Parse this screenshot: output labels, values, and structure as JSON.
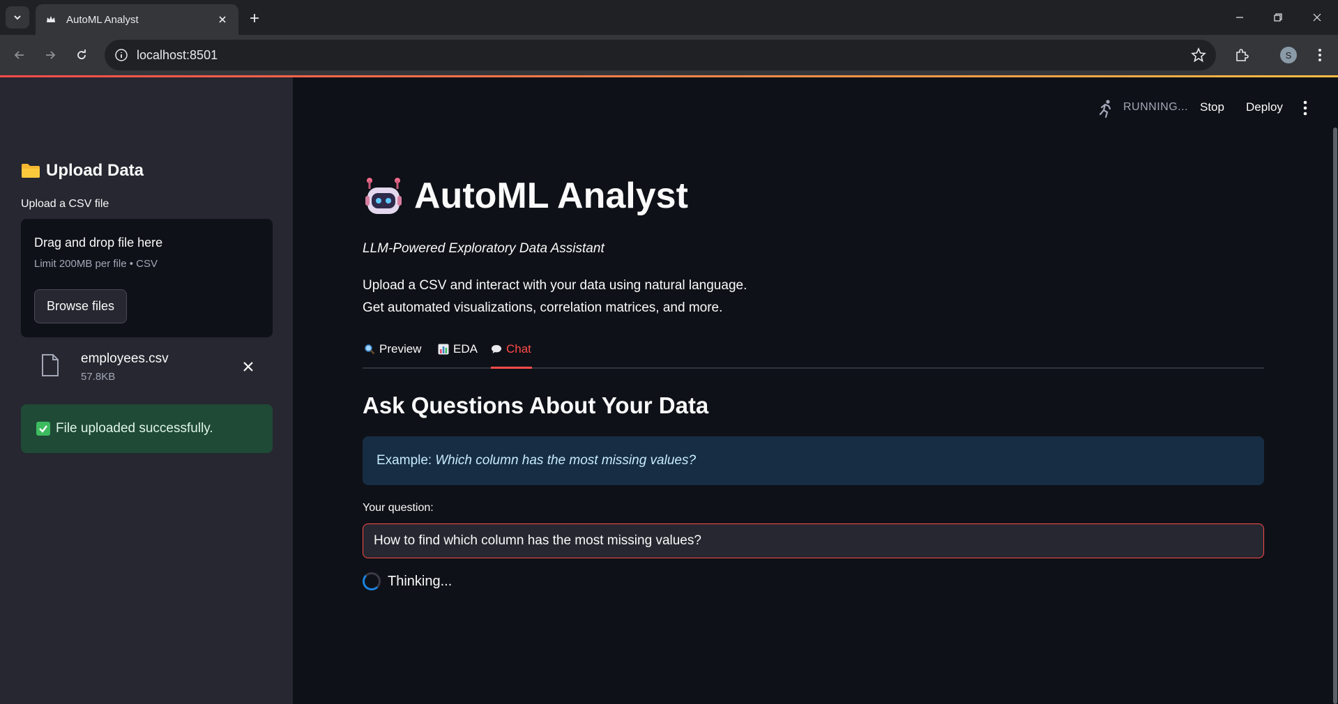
{
  "browser": {
    "tab_title": "AutoML Analyst",
    "url": "localhost:8501",
    "profile_initial": "S"
  },
  "sidebar": {
    "header": "Upload Data",
    "upload_label": "Upload a CSV file",
    "dropzone_title": "Drag and drop file here",
    "dropzone_limit": "Limit 200MB per file • CSV",
    "browse_label": "Browse files",
    "file": {
      "name": "employees.csv",
      "size": "57.8KB"
    },
    "success_message": "File uploaded successfully."
  },
  "header": {
    "status": "RUNNING...",
    "stop_label": "Stop",
    "deploy_label": "Deploy"
  },
  "main": {
    "title": "AutoML Analyst",
    "subtitle": "LLM-Powered Exploratory Data Assistant",
    "desc_line1": "Upload a CSV and interact with your data using natural language.",
    "desc_line2": "Get automated visualizations, correlation matrices, and more.",
    "tabs": [
      {
        "label": "Preview"
      },
      {
        "label": "EDA"
      },
      {
        "label": "Chat"
      }
    ],
    "active_tab": "Chat",
    "section_title": "Ask Questions About Your Data",
    "example_prefix": "Example:",
    "example_question": "Which column has the most missing values?",
    "question_label": "Your question:",
    "question_value": "How to find which column has the most missing values?",
    "thinking_text": "Thinking..."
  },
  "colors": {
    "accent": "#ff4b4b",
    "background": "#0e1117",
    "sidebar": "#262730",
    "success_bg": "#1f4a36",
    "info_bg": "#172d43",
    "spinner": "#1c83e1"
  }
}
